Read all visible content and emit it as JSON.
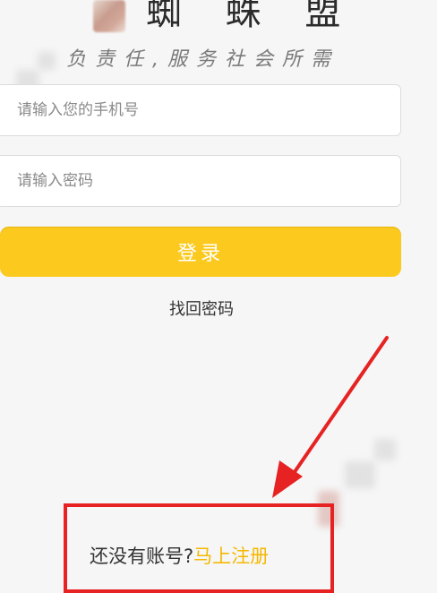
{
  "header": {
    "title": "蜘 蛛 盟",
    "slogan": "负责任,服务社会所需"
  },
  "form": {
    "phone_placeholder": "请输入您的手机号",
    "password_placeholder": "请输入密码",
    "login_label": "登录",
    "forgot_label": "找回密码"
  },
  "footer": {
    "no_account_text": "还没有账号?",
    "signup_label": "马上注册"
  },
  "colors": {
    "accent": "#fcc91e",
    "annotation": "#e62222"
  }
}
